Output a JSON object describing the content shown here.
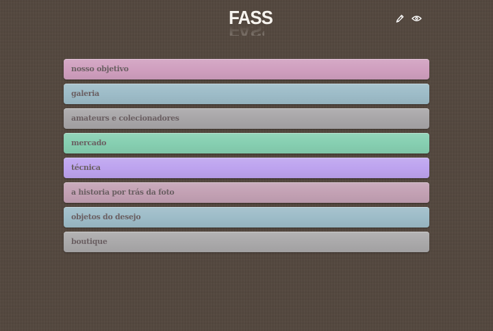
{
  "header": {
    "logo_text": "FASS",
    "edit_icon": "pencil-icon",
    "view_icon": "eye-icon"
  },
  "menu": {
    "items": [
      {
        "label": "nosso objetivo",
        "color": "#d09fbf"
      },
      {
        "label": "galeria",
        "color": "#9dbcc8"
      },
      {
        "label": "amateurs e colecionadores",
        "color": "#a8a6a8"
      },
      {
        "label": "mercado",
        "color": "#86cfb1"
      },
      {
        "label": "técnica",
        "color": "#bda3ef"
      },
      {
        "label": "a historia por trás da foto",
        "color": "#c3a1b4"
      },
      {
        "label": "objetos do desejo",
        "color": "#9dbcc8"
      },
      {
        "label": "boutique",
        "color": "#aaa9aa"
      }
    ]
  },
  "colors": {
    "background": "#54483f",
    "label_text": "#6a5f62",
    "logo": "#f7f4ef",
    "icon": "#ffffff"
  }
}
